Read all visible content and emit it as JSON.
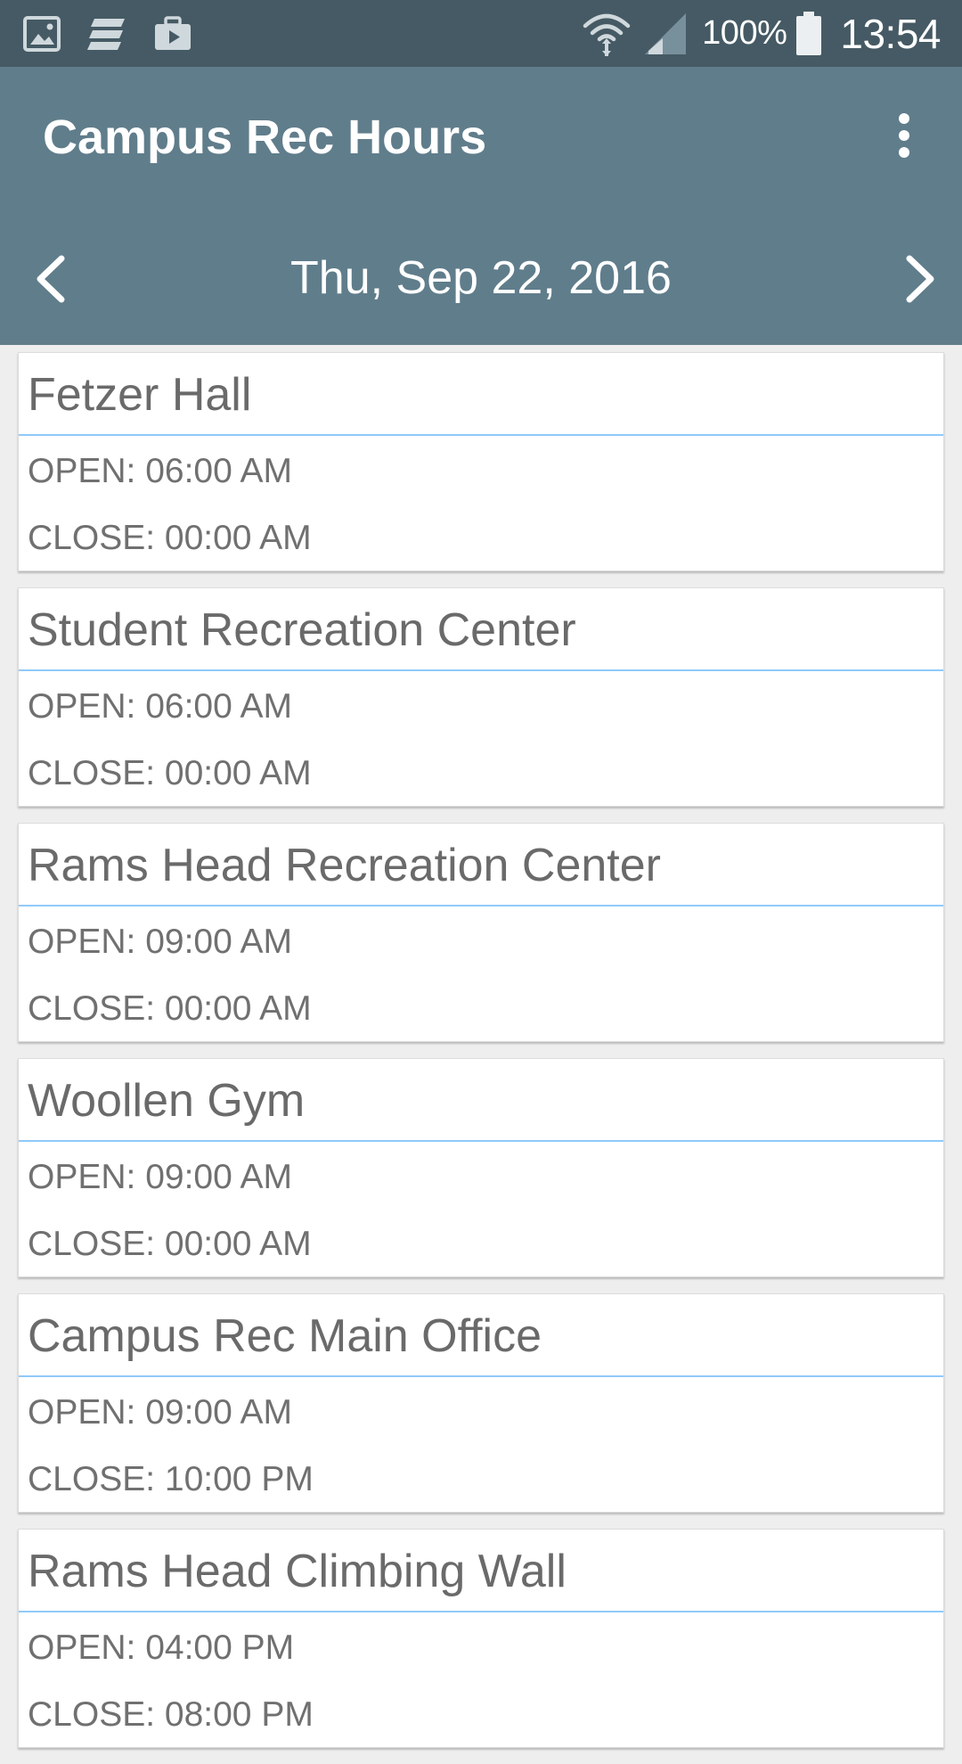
{
  "status_bar": {
    "battery_percent": "100%",
    "time": "13:54"
  },
  "app_bar": {
    "title": "Campus Rec Hours",
    "date": "Thu, Sep 22, 2016"
  },
  "facilities": [
    {
      "name": "Fetzer Hall",
      "open": "OPEN: 06:00 AM",
      "close": "CLOSE: 00:00 AM"
    },
    {
      "name": "Student Recreation Center",
      "open": "OPEN: 06:00 AM",
      "close": "CLOSE: 00:00 AM"
    },
    {
      "name": "Rams Head Recreation Center",
      "open": "OPEN: 09:00 AM",
      "close": "CLOSE: 00:00 AM"
    },
    {
      "name": "Woollen Gym",
      "open": "OPEN: 09:00 AM",
      "close": "CLOSE: 00:00 AM"
    },
    {
      "name": "Campus Rec Main Office",
      "open": "OPEN: 09:00 AM",
      "close": "CLOSE: 10:00 PM"
    },
    {
      "name": "Rams Head Climbing Wall",
      "open": "OPEN: 04:00 PM",
      "close": "CLOSE: 08:00 PM"
    }
  ],
  "colors": {
    "status_bar": "#455a64",
    "app_bar": "#607d8b",
    "card_divider": "#90caf9",
    "background": "#eeeeee"
  },
  "icons": {
    "status_left": [
      "gallery-icon",
      "news-icon",
      "briefcase-play-icon"
    ],
    "status_right": [
      "wifi-icon",
      "signal-icon",
      "battery-icon"
    ],
    "app_bar": [
      "overflow-menu-icon",
      "chevron-left-icon",
      "chevron-right-icon"
    ]
  }
}
